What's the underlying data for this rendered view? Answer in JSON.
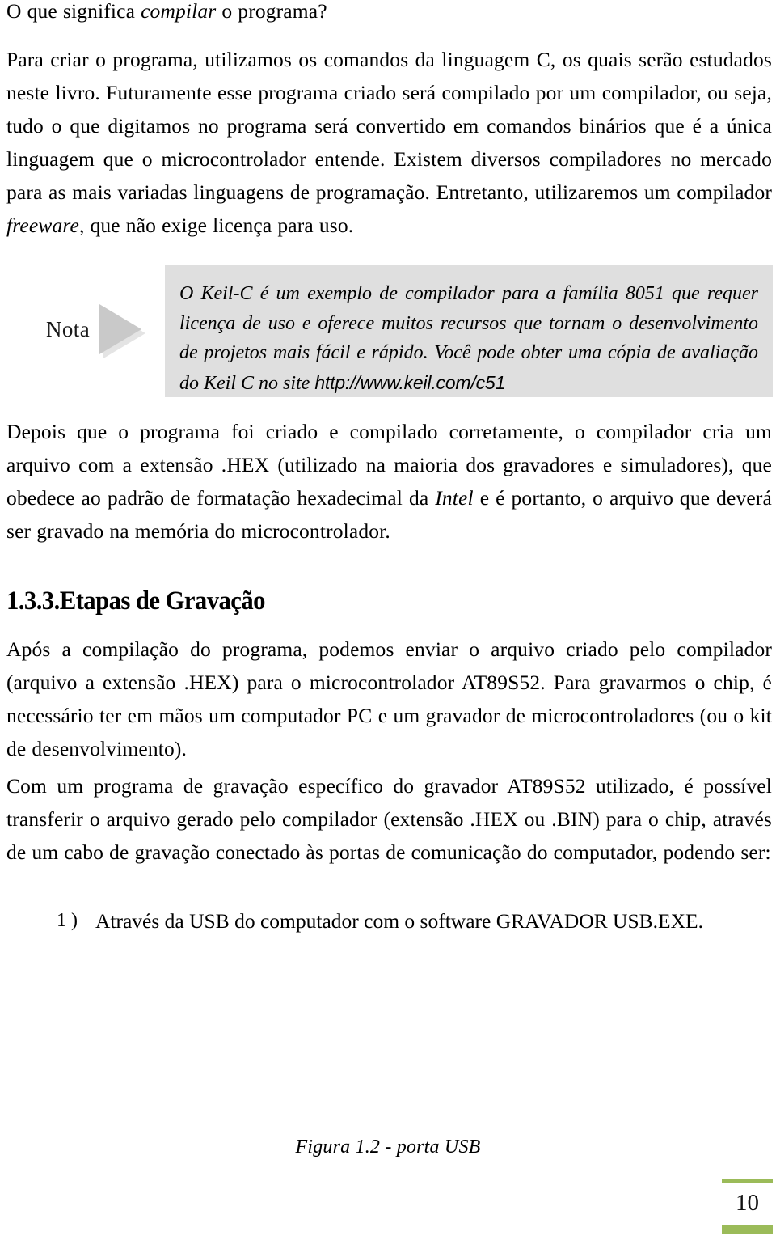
{
  "document": {
    "language": "pt-BR",
    "page_number": "10",
    "accent_color": "#9BBB59",
    "note_background_color": "#DFDFDF",
    "note_arrow_color": "#C9C9C9"
  },
  "lead": {
    "before_italic": "O que significa ",
    "italic": "compilar",
    "after_italic": " o programa?"
  },
  "intro_paragraph": {
    "part_1": "Para criar o programa, utilizamos os comandos da linguagem C, os quais serão estudados neste livro. Futuramente esse programa criado será compilado por um compilador, ou seja, tudo o que digitamos no programa será convertido em comandos binários que é a única linguagem que o microcontrolador entende. Existem diversos compiladores no mercado para as mais variadas linguagens de programação. Entretanto, utilizaremos um compilador ",
    "italic_1": "freeware",
    "part_2": ", que não exige licença para uso."
  },
  "note": {
    "label": "Nota",
    "icon": "triangle-right-icon",
    "text": "O Keil-C é um exemplo de compilador para a família 8051 que requer licença de uso e oferece muitos recursos que tornam o desenvolvimento de projetos mais fácil e rápido. Você pode obter uma cópia de avaliação do Keil C no site ",
    "url": "http://www.keil.com/c51"
  },
  "after_note_paragraph": {
    "part_1": "Depois que o programa foi criado e compilado corretamente, o compilador cria um arquivo com a extensão .HEX (utilizado na maioria dos gravadores e simuladores), que obedece ao padrão de formatação hexadecimal da ",
    "italic_1": "Intel",
    "part_2": " e é portanto, o arquivo que deverá ser gravado na memória do microcontrolador."
  },
  "section": {
    "heading": "1.3.3.Etapas de Gravação",
    "paragraph_1": "Após a compilação do programa, podemos enviar o arquivo criado pelo compilador (arquivo a extensão .HEX) para o microcontrolador AT89S52. Para gravarmos o chip, é necessário ter em mãos um computador PC e um gravador de microcontroladores (ou o kit de desenvolvimento).",
    "paragraph_2": "Com um programa de gravação específico do gravador AT89S52 utilizado, é possível transferir o arquivo gerado pelo compilador (extensão .HEX ou .BIN) para o chip, através de um cabo de gravação conectado às portas de comunicação do computador, podendo ser:"
  },
  "list": {
    "items": [
      {
        "marker": "1 )",
        "text": "Através da USB do computador com o software GRAVADOR USB.EXE."
      }
    ]
  },
  "figure": {
    "caption": "Figura 1.2 - porta USB"
  }
}
